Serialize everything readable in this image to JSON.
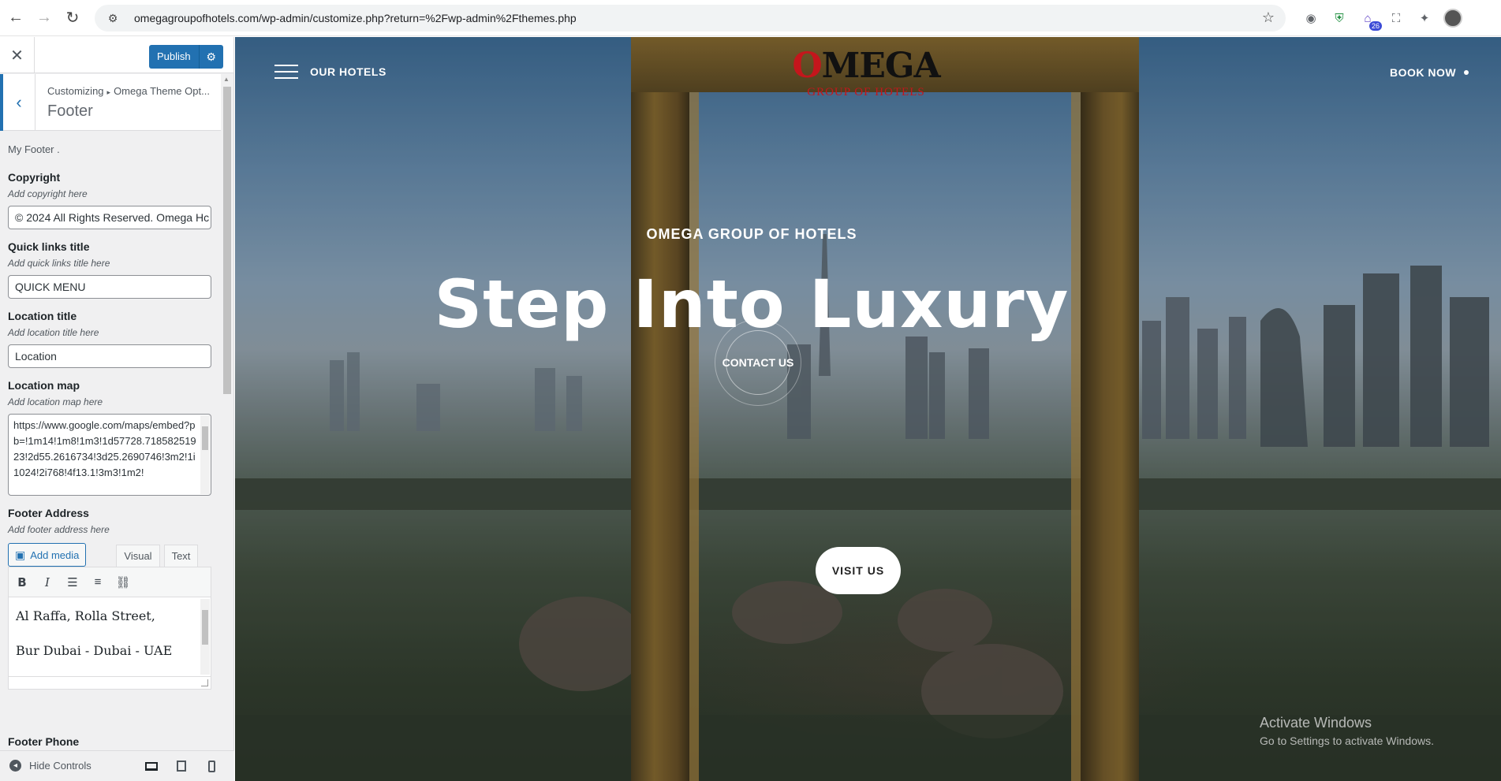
{
  "browser": {
    "url": "omegagroupofhotels.com/wp-admin/customize.php?return=%2Fwp-admin%2Fthemes.php",
    "extension_badge": "26"
  },
  "customizer": {
    "publish_label": "Publish",
    "breadcrumb": [
      "Customizing",
      "Omega Theme Opt..."
    ],
    "section_title": "Footer",
    "section_description": "My Footer .",
    "copyright": {
      "title": "Copyright",
      "description": "Add copyright here",
      "value": "© 2024 All Rights Reserved. Omega Hc"
    },
    "quick_links": {
      "title": "Quick links title",
      "description": "Add quick links title here",
      "value": "QUICK MENU"
    },
    "location_title": {
      "title": "Location title",
      "description": "Add location title here",
      "value": "Location"
    },
    "location_map": {
      "title": "Location map",
      "description": "Add location map here",
      "value": "https://www.google.com/maps/embed?pb=!1m14!1m8!1m3!1d57728.71858251923!2d55.2616734!3d25.2690746!3m2!1i1024!2i768!4f13.1!3m3!1m2!"
    },
    "footer_address": {
      "title": "Footer Address",
      "description": "Add footer address here",
      "add_media_label": "Add media",
      "tab_visual": "Visual",
      "tab_text": "Text",
      "line1": "Al Raffa, Rolla Street,",
      "line2": "Bur Dubai - Dubai - UAE"
    },
    "footer_phone_title": "Footer Phone",
    "hide_controls_label": "Hide Controls"
  },
  "preview": {
    "nav_label": "OUR HOTELS",
    "logo_text": "MEGA",
    "logo_o": "O",
    "logo_subtitle": "GROUP OF HOTELS",
    "book_now": "BOOK NOW",
    "hero_subtitle": "OMEGA GROUP OF HOTELS",
    "hero_title": "Step Into Luxury",
    "contact_label": "CONTACT US",
    "visit_label": "VISIT US"
  },
  "watermark": {
    "line1": "Activate Windows",
    "line2": "Go to Settings to activate Windows."
  },
  "colors": {
    "accent": "#2271b1",
    "logo_red": "#c4161c"
  }
}
